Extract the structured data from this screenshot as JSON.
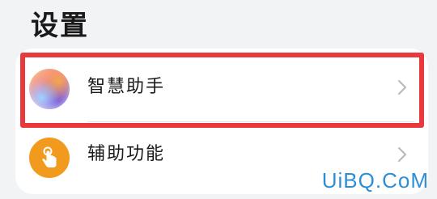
{
  "page": {
    "title": "设置"
  },
  "settings": {
    "items": [
      {
        "label": "智慧助手",
        "icon": "smart-assistant-icon"
      },
      {
        "label": "辅助功能",
        "icon": "accessibility-hand-icon"
      }
    ]
  },
  "colors": {
    "highlight": "#e9393c",
    "accessibility_icon_bg": "#f29a1e",
    "watermark": "#2c8fd6"
  },
  "watermark": {
    "text": "UiBQ.CoM"
  }
}
